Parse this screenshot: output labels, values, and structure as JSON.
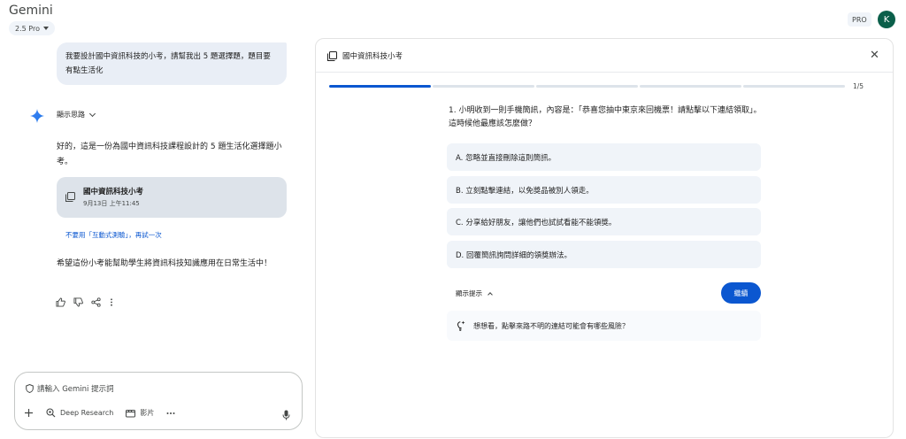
{
  "header": {
    "app_title": "Gemini",
    "model_label": "2.5 Pro",
    "pro_badge": "PRO",
    "avatar_letter": "K"
  },
  "chat": {
    "user_message": "我要設計國中資訊科技的小考，請幫我出 5 題選擇題，題目要有點生活化",
    "thinking_label": "顯示思路",
    "response_text": "好的，這是一份為國中資訊科技課程設計的 5 題生活化選擇題小考。",
    "quiz_card": {
      "title": "國中資訊科技小考",
      "timestamp": "9月13日 上午11:45"
    },
    "retry_link": "不要用「互動式測驗」，再試一次",
    "closing_text": "希望這份小考能幫助學生將資訊科技知識應用在日常生活中！"
  },
  "input": {
    "placeholder": "請輸入 Gemini 提示詞",
    "deep_research_label": "Deep Research",
    "video_label": "影片"
  },
  "panel": {
    "title": "國中資訊科技小考",
    "progress_label": "1/5",
    "progress_current": 1,
    "progress_total": 5,
    "question": "1. 小明收到一則手機簡訊，內容是：「恭喜您抽中東京來回機票！請點擊以下連結領取」。這時候他最應該怎麼做？",
    "options": [
      "A.  忽略並直接刪除這則簡訊。",
      "B.  立刻點擊連結，以免獎品被別人領走。",
      "C.  分享給好朋友，讓他們也試試看能不能領獎。",
      "D.  回覆簡訊詢問詳細的領獎辦法。"
    ],
    "hint_toggle_label": "顯示提示",
    "continue_label": "繼續",
    "hint_text": "想想看，點擊來路不明的連結可能會有哪些風險？"
  },
  "colors": {
    "accent": "#0b57d0",
    "user_bubble": "#e9eef6",
    "card_bg": "#dde3ea",
    "option_bg": "#f0f4f9",
    "avatar_bg": "#0b5f4a"
  },
  "icons": [
    "gemini-star-icon",
    "chevron-down-icon",
    "quiz-doc-icon",
    "thumb-up-icon",
    "thumb-down-icon",
    "share-icon",
    "more-icon",
    "shield-icon",
    "plus-icon",
    "deep-research-icon",
    "video-icon",
    "mic-icon",
    "close-icon",
    "chevron-up-icon",
    "lightbulb-icon"
  ]
}
